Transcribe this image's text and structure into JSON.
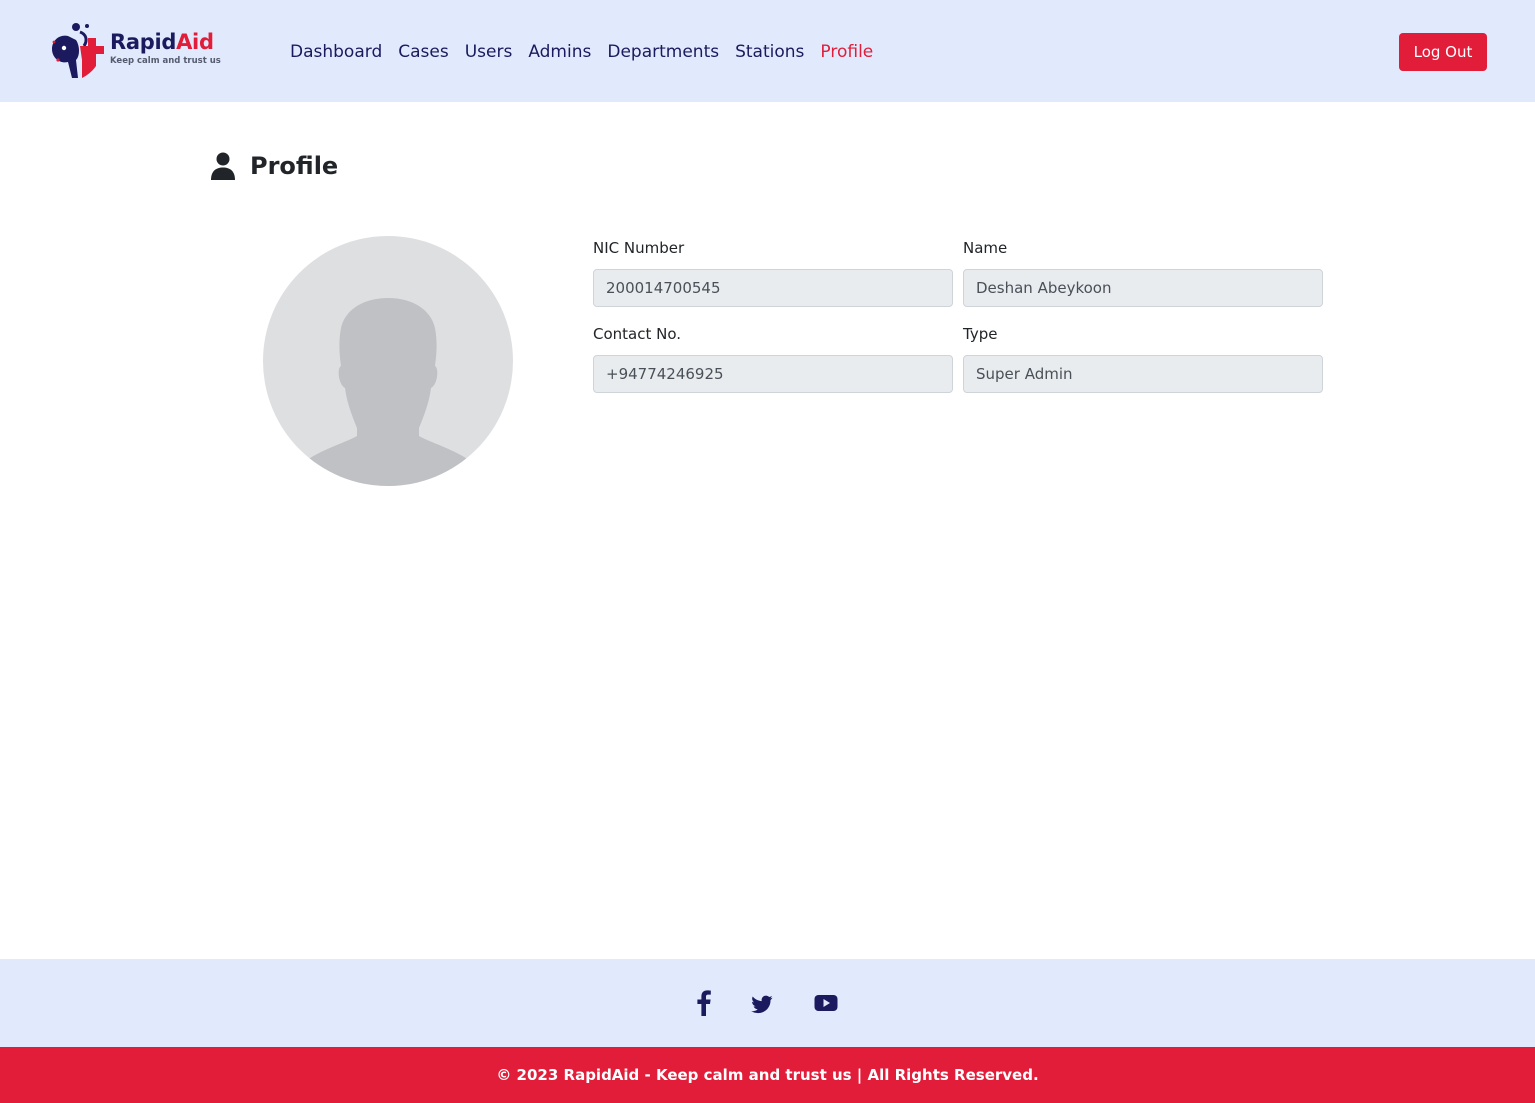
{
  "brand": {
    "name_part1": "Rapid",
    "name_part2": "Aid",
    "tagline": "Keep calm and trust us"
  },
  "colors": {
    "header_bg": "#e1eafc",
    "brand_navy": "#1b1a5e",
    "accent_red": "#e11d3a",
    "input_bg": "#e9ecef"
  },
  "nav": {
    "items": [
      {
        "label": "Dashboard",
        "active": false
      },
      {
        "label": "Cases",
        "active": false
      },
      {
        "label": "Users",
        "active": false
      },
      {
        "label": "Admins",
        "active": false
      },
      {
        "label": "Departments",
        "active": false
      },
      {
        "label": "Stations",
        "active": false
      },
      {
        "label": "Profile",
        "active": true
      }
    ],
    "logout_label": "Log Out"
  },
  "page": {
    "title": "Profile",
    "title_icon": "user-icon"
  },
  "profile": {
    "avatar": "default-avatar-silhouette",
    "nic_label": "NIC Number",
    "nic_value": "200014700545",
    "name_label": "Name",
    "name_value": "Deshan Abeykoon",
    "contact_label": "Contact No.",
    "contact_value": "+94774246925",
    "type_label": "Type",
    "type_value": "Super Admin"
  },
  "footer": {
    "social": [
      "facebook-icon",
      "twitter-icon",
      "youtube-icon"
    ],
    "copyright": "© 2023 RapidAid - Keep calm and trust us | All Rights Reserved."
  }
}
